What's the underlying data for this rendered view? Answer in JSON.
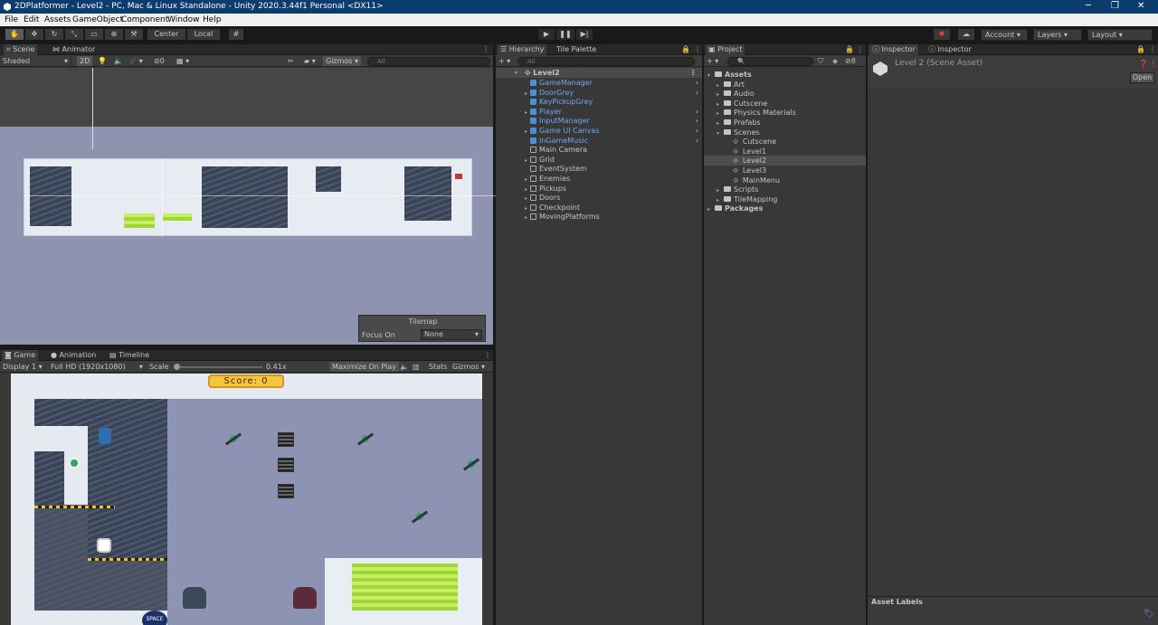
{
  "window": {
    "title": "2DPlatformer - Level2 - PC, Mac & Linux Standalone - Unity 2020.3.44f1 Personal <DX11>",
    "minimize": "─",
    "maximize": "❐",
    "close": "✕"
  },
  "menu": [
    "File",
    "Edit",
    "Assets",
    "GameObject",
    "Component",
    "Window",
    "Help"
  ],
  "toolbar": {
    "center": "Center",
    "local": "Local",
    "account": "Account",
    "layers": "Layers",
    "layout": "Layout"
  },
  "scene": {
    "tab": "Scene",
    "tab2": "Animator",
    "shading": "Shaded",
    "mode2d": "2D",
    "gizmos": "Gizmos",
    "search": "All",
    "hidden_count": "0",
    "tilemap": {
      "title": "Tilemap",
      "focus_label": "Focus On",
      "focus_value": "None"
    }
  },
  "game": {
    "tabs": [
      "Game",
      "Animation",
      "Timeline"
    ],
    "display": "Display 1",
    "resolution": "Full HD (1920x1080)",
    "scale_label": "Scale",
    "scale_value": "0.41x",
    "scale_fraction": 0.02,
    "maximize": "Maximize On Play",
    "stats": "Stats",
    "gizmos": "Gizmos",
    "score": "Score: 0",
    "badge": "SPACE"
  },
  "hierarchy": {
    "tab": "Hierarchy",
    "tab2": "Tile Palette",
    "search": "All",
    "root": "Level2",
    "items": [
      {
        "label": "GameManager",
        "blue": true,
        "expand": false
      },
      {
        "label": "DoorGrey",
        "blue": true,
        "expand": true
      },
      {
        "label": "KeyPickupGrey",
        "blue": true,
        "expand": false
      },
      {
        "label": "Player",
        "blue": true,
        "expand": true
      },
      {
        "label": "InputManager",
        "blue": true,
        "expand": false
      },
      {
        "label": "Game UI Canvas",
        "blue": true,
        "expand": true
      },
      {
        "label": "InGameMusic",
        "blue": true,
        "expand": false
      },
      {
        "label": "Main Camera",
        "blue": false,
        "expand": false
      },
      {
        "label": "Grid",
        "blue": false,
        "expand": true
      },
      {
        "label": "EventSystem",
        "blue": false,
        "expand": false
      },
      {
        "label": "Enemies",
        "blue": false,
        "expand": true
      },
      {
        "label": "Pickups",
        "blue": false,
        "expand": true
      },
      {
        "label": "Doors",
        "blue": false,
        "expand": true
      },
      {
        "label": "Checkpoint",
        "blue": false,
        "expand": true
      },
      {
        "label": "MovingPlatforms",
        "blue": false,
        "expand": true
      }
    ]
  },
  "project": {
    "tab": "Project",
    "hidden_count": "8",
    "items": [
      {
        "label": "Assets",
        "type": "folder",
        "depth": 0,
        "open": true,
        "bold": true
      },
      {
        "label": "Art",
        "type": "folder",
        "depth": 1
      },
      {
        "label": "Audio",
        "type": "folder",
        "depth": 1
      },
      {
        "label": "Cutscene",
        "type": "folder",
        "depth": 1
      },
      {
        "label": "Physics Materials",
        "type": "folder",
        "depth": 1
      },
      {
        "label": "Prefabs",
        "type": "folder",
        "depth": 1
      },
      {
        "label": "Scenes",
        "type": "folder",
        "depth": 1,
        "open": true
      },
      {
        "label": "Cutscene",
        "type": "scene",
        "depth": 2
      },
      {
        "label": "Level1",
        "type": "scene",
        "depth": 2
      },
      {
        "label": "Level2",
        "type": "scene",
        "depth": 2,
        "selected": true
      },
      {
        "label": "Level3",
        "type": "scene",
        "depth": 2
      },
      {
        "label": "MainMenu",
        "type": "scene",
        "depth": 2
      },
      {
        "label": "Scripts",
        "type": "folder",
        "depth": 1
      },
      {
        "label": "TileMapping",
        "type": "folder",
        "depth": 1
      },
      {
        "label": "Packages",
        "type": "folder",
        "depth": 0,
        "bold": true
      }
    ]
  },
  "inspector": {
    "tab": "Inspector",
    "tab2": "Inspector",
    "asset": "Level 2 (Scene Asset)",
    "open": "Open",
    "labels": "Asset Labels"
  }
}
